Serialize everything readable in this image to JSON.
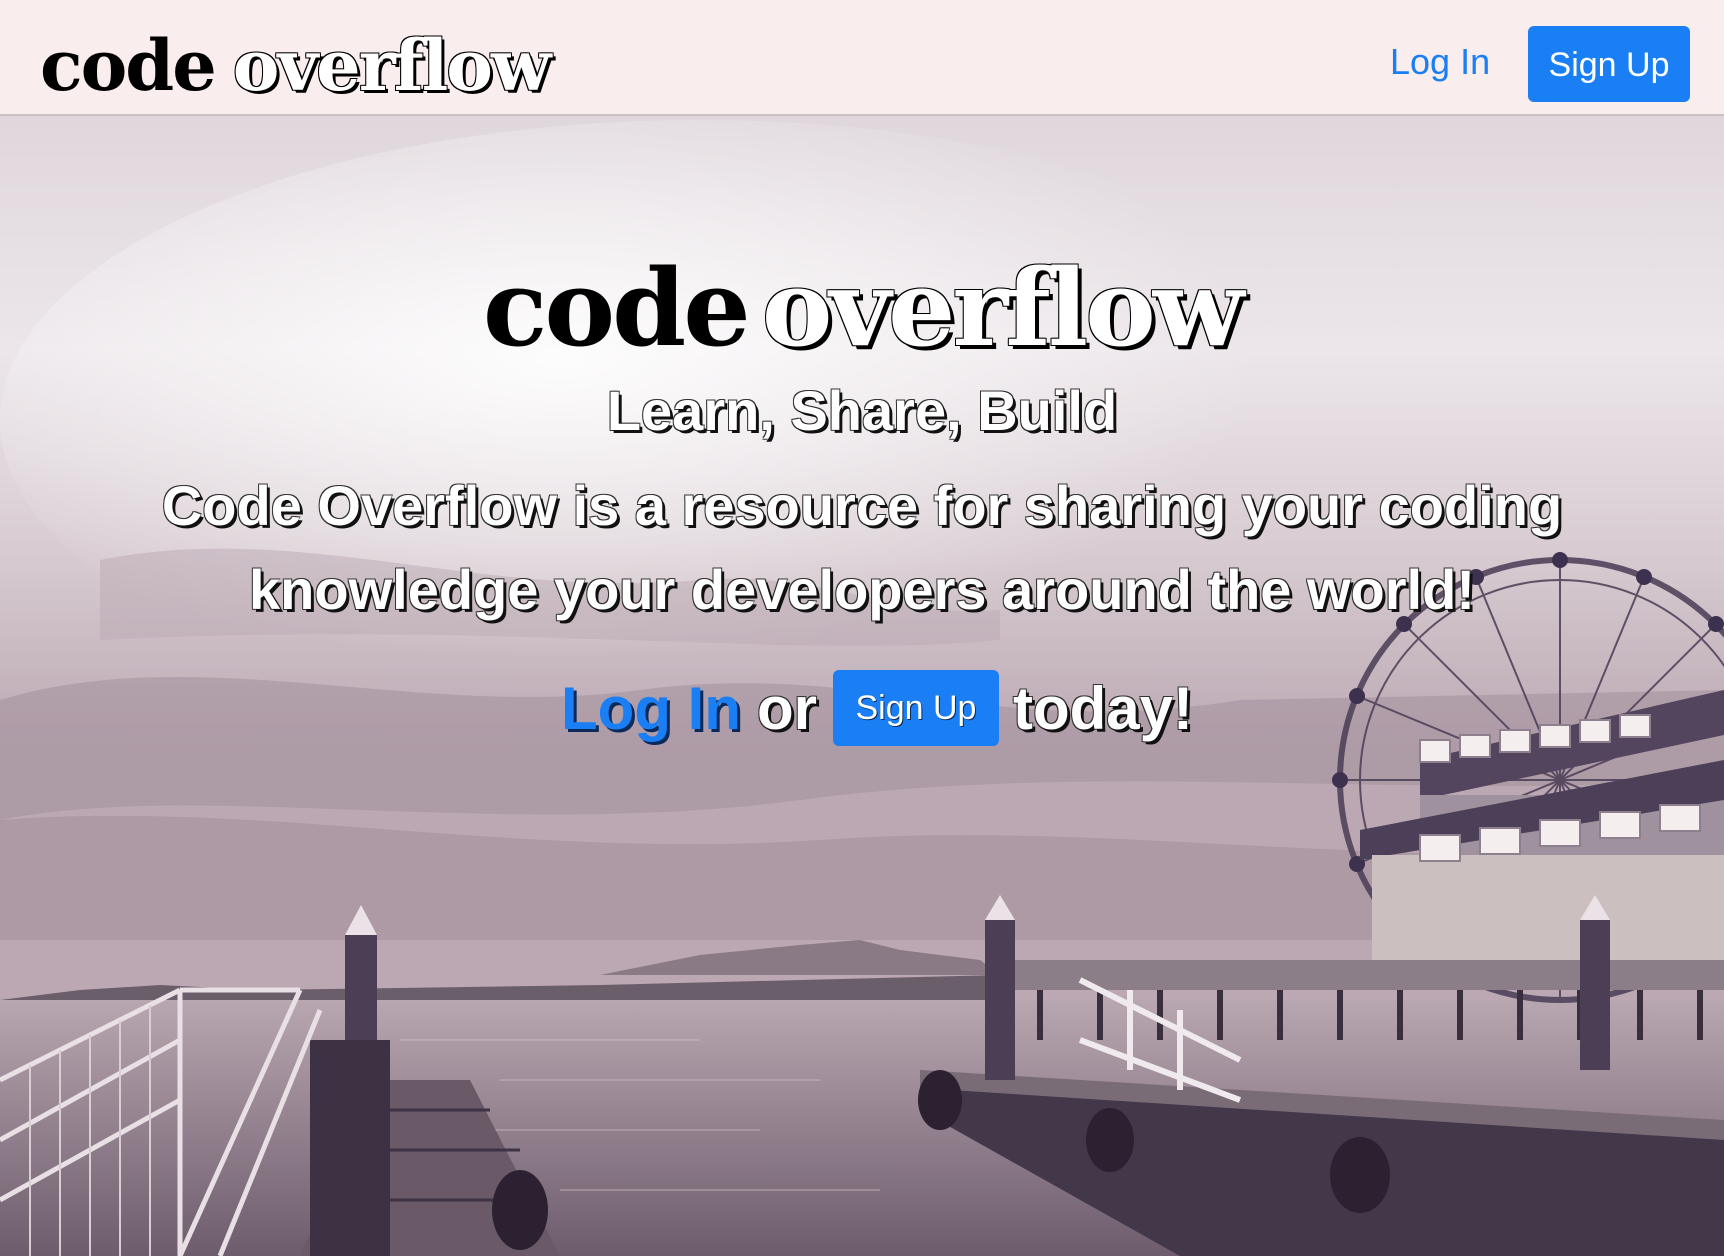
{
  "navbar": {
    "logo_code": "code",
    "logo_overflow": "overflow",
    "login_label": "Log In",
    "signup_label": "Sign Up"
  },
  "hero": {
    "logo_code": "code",
    "logo_overflow": "overflow",
    "tagline": "Learn, Share, Build",
    "description": "Code Overflow is a resource for sharing your coding knowledge your developers around the world!",
    "cta_login": "Log In",
    "cta_or": "or",
    "cta_signup": "Sign Up",
    "cta_today": "today!"
  },
  "colors": {
    "accent": "#1a7ef4",
    "navbar_bg": "#f9eded"
  },
  "background": {
    "subject": "waterfront pier with ferris wheel"
  }
}
